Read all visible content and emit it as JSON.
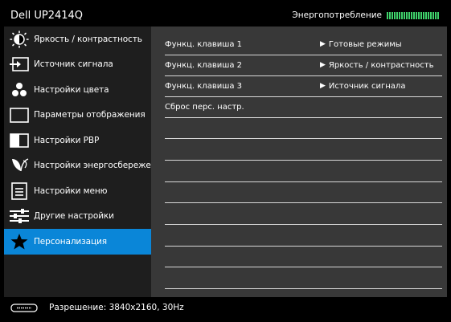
{
  "header": {
    "title": "Dell UP2414Q",
    "energy_label": "Энергопотребление",
    "energy_segments": 22,
    "energy_color": "#3fd26b"
  },
  "sidebar": {
    "active_color": "#0a86d8",
    "items": [
      {
        "label": "Яркость / контрастность",
        "icon": "brightness-icon",
        "active": false
      },
      {
        "label": "Источник сигнала",
        "icon": "input-source-icon",
        "active": false
      },
      {
        "label": "Настройки цвета",
        "icon": "color-dots-icon",
        "active": false
      },
      {
        "label": "Параметры отображения",
        "icon": "display-icon",
        "active": false
      },
      {
        "label": "Настройки PBP",
        "icon": "pbp-icon",
        "active": false
      },
      {
        "label": "Настройки энергосбережения",
        "icon": "leaf-icon",
        "active": false
      },
      {
        "label": "Настройки меню",
        "icon": "menu-icon",
        "active": false
      },
      {
        "label": "Другие настройки",
        "icon": "sliders-icon",
        "active": false
      },
      {
        "label": "Персонализация",
        "icon": "star-icon",
        "active": true
      }
    ]
  },
  "main": {
    "rows": [
      {
        "name": "Функц. клавиша 1",
        "value": "Готовые режимы"
      },
      {
        "name": "Функц. клавиша 2",
        "value": "Яркость / контрастность"
      },
      {
        "name": "Функц. клавиша 3",
        "value": "Источник сигнала"
      },
      {
        "name": "Сброс перс. настр.",
        "value": ""
      },
      {
        "name": "",
        "value": ""
      },
      {
        "name": "",
        "value": ""
      },
      {
        "name": "",
        "value": ""
      },
      {
        "name": "",
        "value": ""
      },
      {
        "name": "",
        "value": ""
      },
      {
        "name": "",
        "value": ""
      },
      {
        "name": "",
        "value": ""
      },
      {
        "name": "",
        "value": ""
      }
    ]
  },
  "footer": {
    "resolution": "Разрешение: 3840x2160, 30Hz",
    "port_icon": "port-icon"
  }
}
